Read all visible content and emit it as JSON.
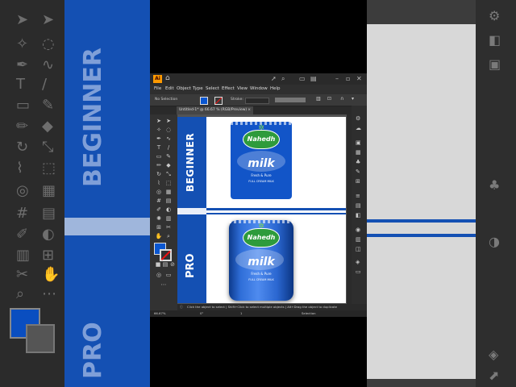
{
  "app": {
    "badge": "Ai",
    "menus": [
      "File",
      "Edit",
      "Object",
      "Type",
      "Select",
      "Effect",
      "View",
      "Window",
      "Help"
    ],
    "control": {
      "selection_label": "No Selection",
      "stroke_label": "Stroke:"
    },
    "document_tab": "Untitled-1* @ 66.67 % (RGB/Preview)",
    "tab_close": "×",
    "status_hint": "Click the object to select  |  Shift+Click to select multiple objects  |  Alt+Drag the object to duplicate",
    "zoom": "66.67%",
    "angle": "0°",
    "artboard_no": "1",
    "status_mode": "Selection"
  },
  "canvas": {
    "label_top": "BEGINNER",
    "label_bottom": "PRO",
    "brand": "Nahedh",
    "product": "milk",
    "tagline": "Fresh & Pure",
    "subline": "FULL CREAM MILK"
  },
  "background": {
    "label_top": "BEGINNER",
    "label_bottom": "PRO"
  },
  "colors": {
    "accent_blue": "#1450b3",
    "fill": "#0a56d0",
    "ai_orange": "#ff9a00"
  },
  "icons": {
    "home": "home-icon",
    "search": "search-icon",
    "selection": "selection-tool-icon"
  }
}
